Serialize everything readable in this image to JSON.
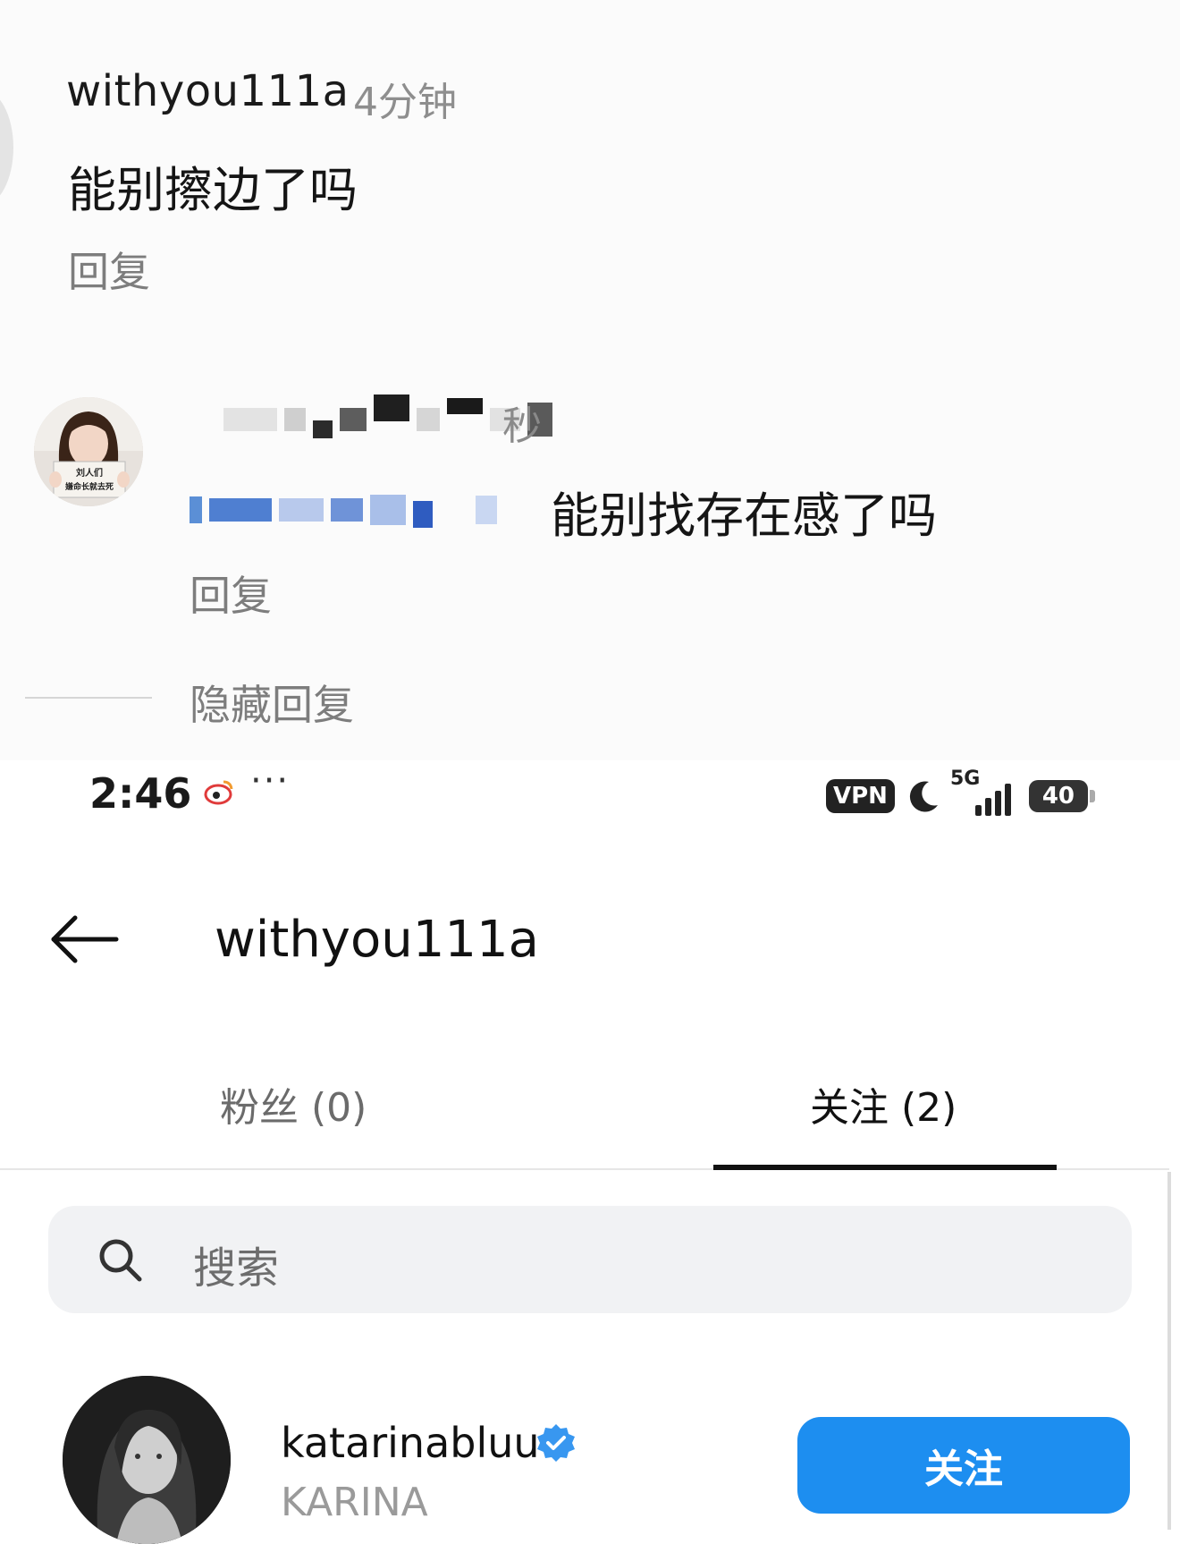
{
  "comments": [
    {
      "username": "withyou111a",
      "time": "4分钟",
      "text": "能别擦边了吗",
      "reply_label": "回复"
    },
    {
      "time": "秒",
      "text": "能别找存在感了吗",
      "reply_label": "回复",
      "avatar_sign_lines": [
        "刘人们",
        "嫌命长就去死"
      ]
    }
  ],
  "hide_replies_label": "隐藏回复",
  "status_bar": {
    "time": "2:46",
    "more": "···",
    "vpn": "VPN",
    "network": "5G",
    "battery": "40"
  },
  "profile": {
    "title": "withyou111a",
    "tabs": [
      {
        "label": "粉丝 (0)",
        "active": false
      },
      {
        "label": "关注 (2)",
        "active": true
      }
    ],
    "search_placeholder": "搜索",
    "following": [
      {
        "handle": "katarinabluu",
        "name": "KARINA",
        "verified": true,
        "button_label": "关注"
      }
    ]
  },
  "colors": {
    "accent_blue": "#1d8ef0",
    "verified_blue": "#3897f0",
    "muted_text": "#8e8e8e"
  }
}
